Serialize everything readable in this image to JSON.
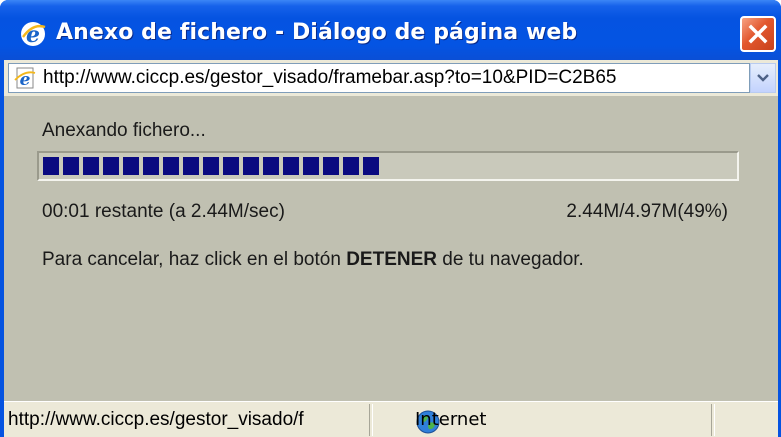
{
  "window": {
    "title": "Anexo de fichero - Diálogo de página web"
  },
  "address_bar": {
    "url": "http://www.ciccp.es/gestor_visado/framebar.asp?to=10&PID=C2B65"
  },
  "upload": {
    "status_label": "Anexando fichero...",
    "progress_percent": 49,
    "time_remaining": "00:01 restante (a 2.44M/sec)",
    "size_progress": "2.44M/4.97M(49%)",
    "cancel_hint_before": "Para cancelar, haz click en el botón ",
    "cancel_hint_bold": "DETENER",
    "cancel_hint_after": " de tu navegador."
  },
  "status_bar": {
    "url": "http://www.ciccp.es/gestor_visado/f",
    "zone": "Internet"
  },
  "icons": {
    "title": "ie-icon",
    "close": "close-icon",
    "address": "ie-page-icon",
    "dropdown": "chevron-down-icon",
    "zone": "globe-icon"
  },
  "colors": {
    "titlebar": "#0553e1",
    "dialog_background": "#c0c0b1",
    "progress_fill": "#0a0a80",
    "close_button": "#e2572e"
  }
}
